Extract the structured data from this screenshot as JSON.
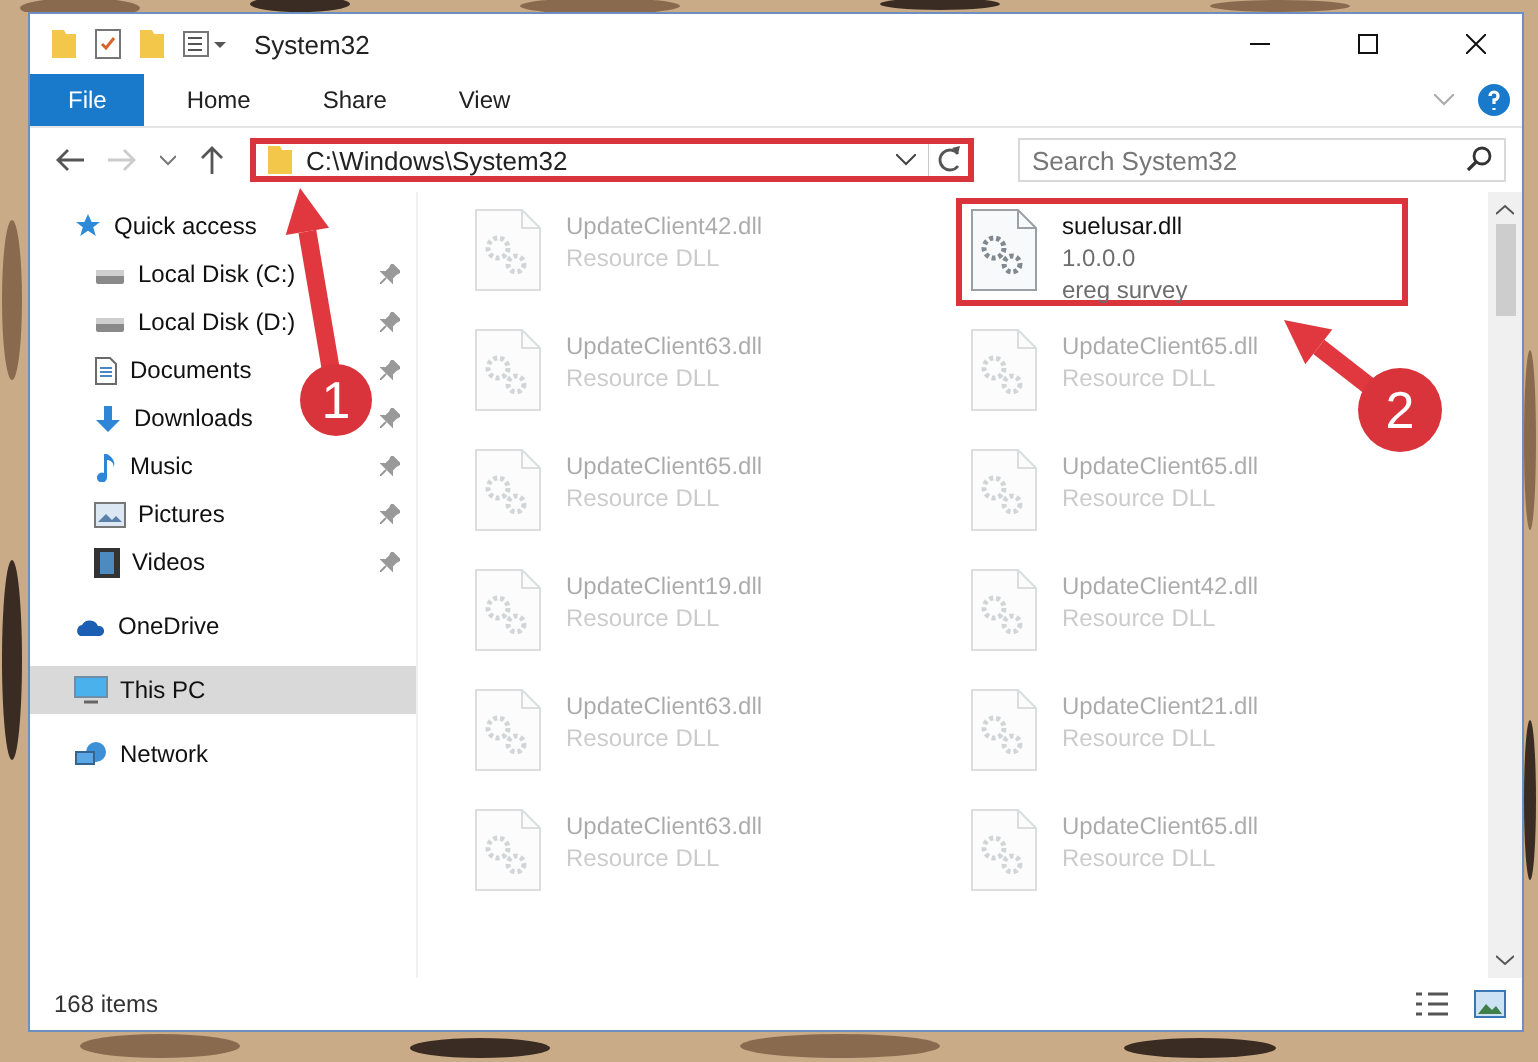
{
  "window": {
    "title": "System32"
  },
  "ribbon": {
    "tabs": [
      {
        "label": "File",
        "kind": "file"
      },
      {
        "label": "Home",
        "kind": "tab"
      },
      {
        "label": "Share",
        "kind": "tab"
      },
      {
        "label": "View",
        "kind": "tab"
      }
    ]
  },
  "address": {
    "path": "C:\\Windows\\System32",
    "highlighted": true
  },
  "search": {
    "placeholder": "Search System32"
  },
  "sidebar": {
    "items": [
      {
        "label": "Quick access",
        "kind": "star",
        "selected": false,
        "children": [
          {
            "label": "Local Disk (C:)",
            "kind": "drive",
            "pinned": true
          },
          {
            "label": "Local Disk (D:)",
            "kind": "drive",
            "pinned": true
          },
          {
            "label": "Documents",
            "kind": "document",
            "pinned": true
          },
          {
            "label": "Downloads",
            "kind": "download",
            "pinned": true
          },
          {
            "label": "Music",
            "kind": "music",
            "pinned": true
          },
          {
            "label": "Pictures",
            "kind": "pictures",
            "pinned": true
          },
          {
            "label": "Videos",
            "kind": "video",
            "pinned": true
          }
        ]
      },
      {
        "label": "OneDrive",
        "kind": "cloud",
        "selected": false
      },
      {
        "label": "This PC",
        "kind": "pc",
        "selected": true
      },
      {
        "label": "Network",
        "kind": "network",
        "selected": false
      }
    ]
  },
  "files": [
    {
      "name": "UpdateClient42.dll",
      "details": [
        "Resource DLL"
      ],
      "faded": true,
      "highlighted": false
    },
    {
      "name": "suelusar.dll",
      "details": [
        "1.0.0.0",
        "ereg survey"
      ],
      "faded": false,
      "highlighted": true
    },
    {
      "name": "UpdateClient63.dll",
      "details": [
        "Resource DLL"
      ],
      "faded": true,
      "highlighted": false
    },
    {
      "name": "UpdateClient65.dll",
      "details": [
        "Resource DLL"
      ],
      "faded": true,
      "highlighted": false
    },
    {
      "name": "UpdateClient65.dll",
      "details": [
        "Resource DLL"
      ],
      "faded": true,
      "highlighted": false
    },
    {
      "name": "UpdateClient65.dll",
      "details": [
        "Resource DLL"
      ],
      "faded": true,
      "highlighted": false
    },
    {
      "name": "UpdateClient19.dll",
      "details": [
        "Resource DLL"
      ],
      "faded": true,
      "highlighted": false
    },
    {
      "name": "UpdateClient42.dll",
      "details": [
        "Resource DLL"
      ],
      "faded": true,
      "highlighted": false
    },
    {
      "name": "UpdateClient63.dll",
      "details": [
        "Resource DLL"
      ],
      "faded": true,
      "highlighted": false
    },
    {
      "name": "UpdateClient21.dll",
      "details": [
        "Resource DLL"
      ],
      "faded": true,
      "highlighted": false
    },
    {
      "name": "UpdateClient63.dll",
      "details": [
        "Resource DLL"
      ],
      "faded": true,
      "highlighted": false
    },
    {
      "name": "UpdateClient65.dll",
      "details": [
        "Resource DLL"
      ],
      "faded": true,
      "highlighted": false
    }
  ],
  "status_bar": {
    "count": "168 items"
  },
  "annotations": [
    {
      "label": "1"
    },
    {
      "label": "2"
    }
  ]
}
